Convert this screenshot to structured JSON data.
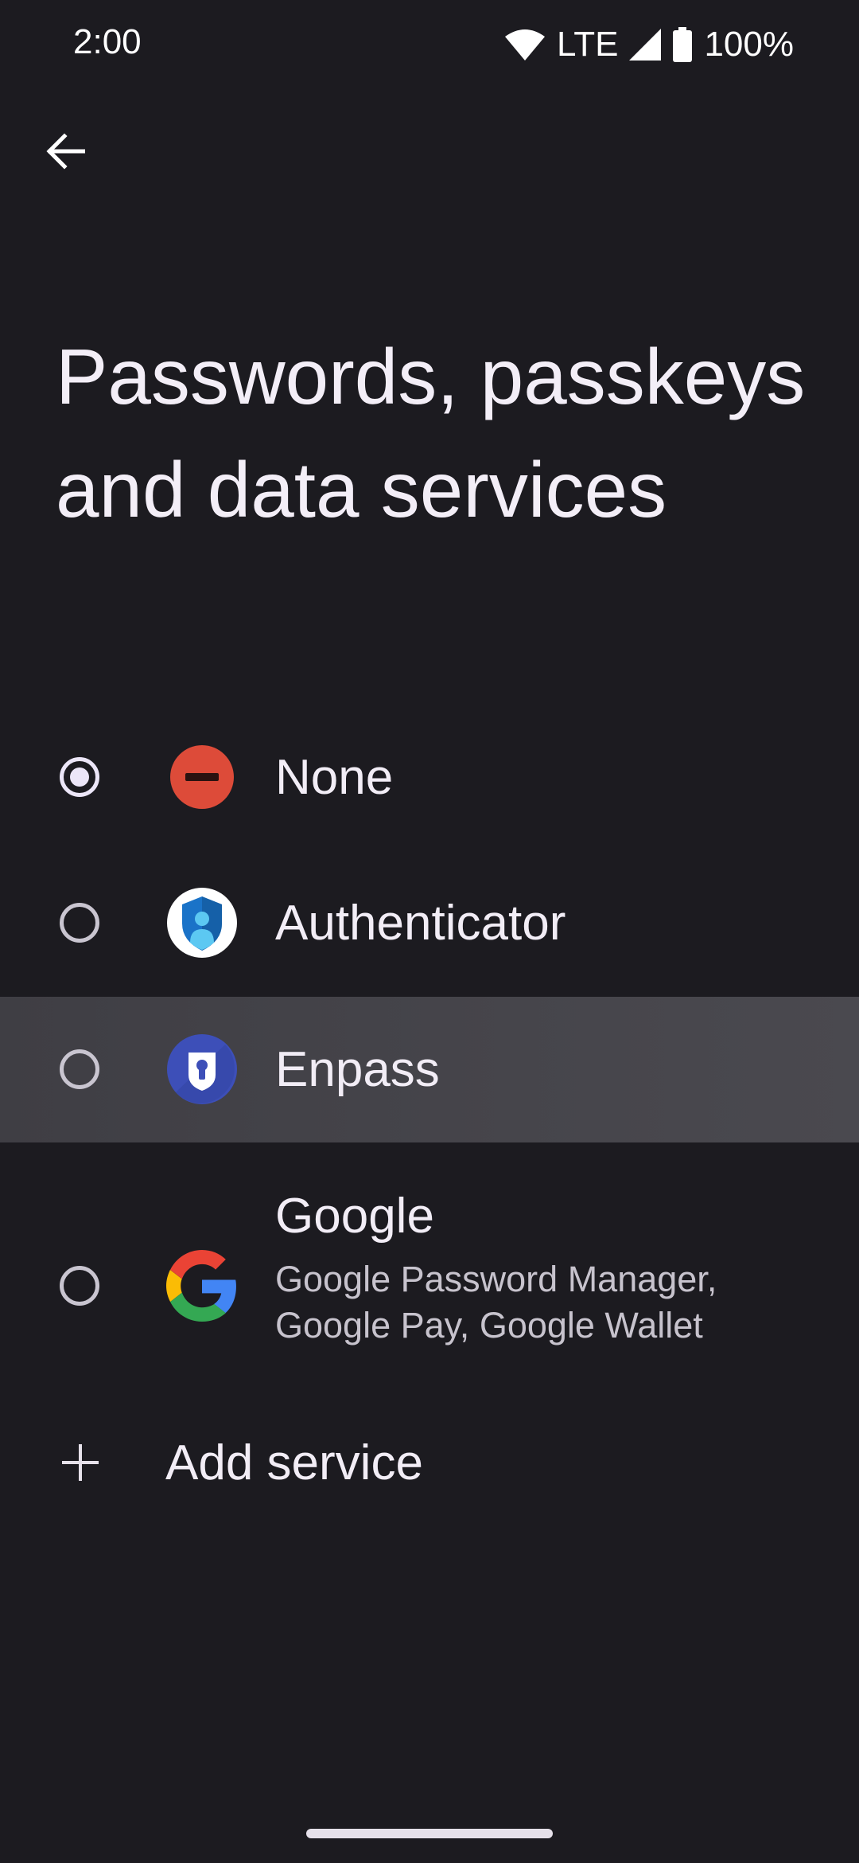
{
  "status_bar": {
    "time": "2:00",
    "network": "LTE",
    "battery": "100%",
    "icons": [
      "wifi-icon",
      "signal-icon",
      "battery-icon"
    ]
  },
  "header": {
    "back_icon": "arrow-back-icon"
  },
  "page": {
    "title": "Passwords, passkeys and data services"
  },
  "options": [
    {
      "label": "None",
      "icon": "remove-circle-icon",
      "selected": true,
      "icon_color": "#dd4b39"
    },
    {
      "label": "Authenticator",
      "icon": "authenticator-app-icon",
      "selected": false,
      "icon_color": "#1a73c8"
    },
    {
      "label": "Enpass",
      "icon": "enpass-app-icon",
      "selected": false,
      "icon_color": "#3d4fb8"
    },
    {
      "label": "Google",
      "subtitle": "Google Password Manager, Google Pay, Google Wallet",
      "icon": "google-app-icon",
      "selected": false
    }
  ],
  "add_service": {
    "label": "Add service",
    "icon": "plus-icon"
  },
  "colors": {
    "background": "#1c1b20",
    "highlight_row": "#444349",
    "text_primary": "#f2edf6",
    "text_secondary": "#c7c3cd"
  }
}
